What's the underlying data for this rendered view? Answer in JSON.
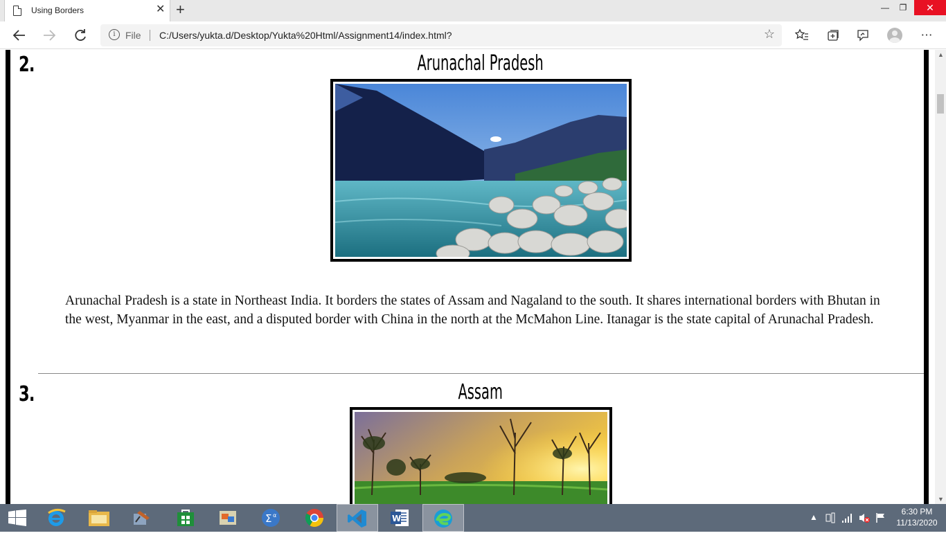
{
  "browser": {
    "tab_title": "Using Borders",
    "tab_close": "✕",
    "new_tab": "+",
    "address": {
      "scheme": "File",
      "url": "C:/Users/yukta.d/Desktop/Yukta%20Html/Assignment14/index.html?"
    },
    "window_controls": {
      "minimize": "—",
      "restore": "❐",
      "close": "✕"
    }
  },
  "page": {
    "items": [
      {
        "number": "2.",
        "heading": "Arunachal Pradesh",
        "description": "Arunachal Pradesh is a state in Northeast India. It borders the states of Assam and Nagaland to the south. It shares international borders with Bhutan in the west, Myanmar in the east, and a disputed border with China in the north at the McMahon Line. Itanagar is the state capital of Arunachal Pradesh."
      },
      {
        "number": "3.",
        "heading": "Assam"
      }
    ]
  },
  "taskbar": {
    "apps": [
      "start",
      "internet-explorer",
      "file-explorer",
      "tool-app",
      "store",
      "control-panel",
      "math-input",
      "chrome",
      "vscode",
      "word",
      "edge"
    ],
    "clock": {
      "time": "6:30 PM",
      "date": "11/13/2020"
    }
  }
}
